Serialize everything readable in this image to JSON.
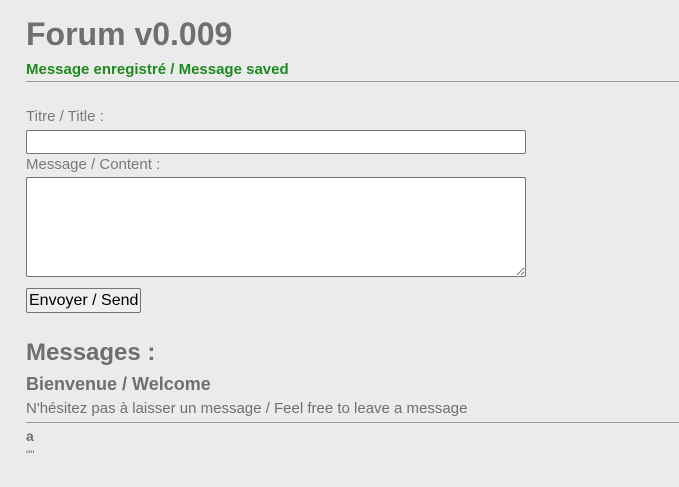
{
  "page": {
    "title": "Forum v0.009",
    "status_message": "Message enregistré / Message saved"
  },
  "form": {
    "title_label": "Titre / Title :",
    "title_value": "",
    "content_label": "Message / Content :",
    "content_value": "",
    "submit_label": "Envoyer / Send"
  },
  "messages": {
    "heading": "Messages :",
    "items": [
      {
        "title": "Bienvenue / Welcome",
        "body": "N'hésitez pas à laisser un message / Feel free to leave a message"
      },
      {
        "title": "a",
        "body": "\"\""
      }
    ]
  },
  "colors": {
    "background": "#ebebeb",
    "text": "#6f6f6f",
    "status": "#1f8a1f"
  }
}
